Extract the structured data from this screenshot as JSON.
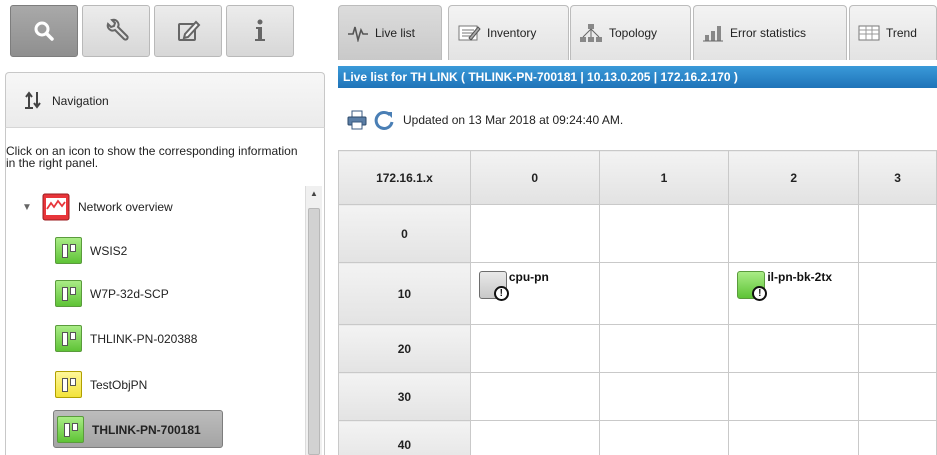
{
  "left_panel": {
    "top_buttons": [
      {
        "icon": "search-icon",
        "active": true
      },
      {
        "icon": "wrench-icon",
        "active": false
      },
      {
        "icon": "edit-document-icon",
        "active": false
      },
      {
        "icon": "info-icon",
        "active": false
      }
    ],
    "navigation_header": {
      "icon": "sort-arrows-icon",
      "label": "Navigation"
    },
    "hint": "Click on an icon to show the corresponding information in the right panel.",
    "tree": {
      "root": {
        "label": "Network overview",
        "icon": "network-overview-icon",
        "expanded": true
      },
      "items": [
        {
          "label": "WSIS2",
          "icon": "device-green-icon",
          "selected": false
        },
        {
          "label": "W7P-32d-SCP",
          "icon": "device-green-icon",
          "selected": false
        },
        {
          "label": "THLINK-PN-020388",
          "icon": "device-green-icon",
          "selected": false
        },
        {
          "label": "TestObjPN",
          "icon": "device-yellow-icon",
          "selected": false
        },
        {
          "label": "THLINK-PN-700181",
          "icon": "device-green-icon",
          "selected": true
        }
      ]
    }
  },
  "tabs": [
    {
      "label": "Live list",
      "icon": "pulse-icon",
      "active": true
    },
    {
      "label": "Inventory",
      "icon": "inventory-icon",
      "active": false
    },
    {
      "label": "Topology",
      "icon": "topology-icon",
      "active": false
    },
    {
      "label": "Error statistics",
      "icon": "bar-chart-icon",
      "active": false
    },
    {
      "label": "Trend",
      "icon": "trend-icon",
      "active": false
    }
  ],
  "live_list": {
    "title": "Live list for TH LINK ( THLINK-PN-700181 | 10.13.0.205 | 172.16.2.170 )",
    "updated": "Updated on 13 Mar 2018 at 09:24:40 AM.",
    "grid": {
      "corner": "172.16.1.x",
      "columns": [
        "0",
        "1",
        "2",
        "3"
      ],
      "rows": [
        "0",
        "10",
        "20",
        "30",
        "40"
      ],
      "devices": [
        {
          "row": "10",
          "col": "0",
          "name": "cpu-pn",
          "status": "warning",
          "style": "grey"
        },
        {
          "row": "10",
          "col": "2",
          "name": "il-pn-bk-2tx",
          "status": "warning",
          "style": "green"
        }
      ]
    }
  },
  "colors": {
    "title_bar": "#1f73b8",
    "device_green": "#5ec336",
    "device_yellow": "#f2e33a"
  }
}
